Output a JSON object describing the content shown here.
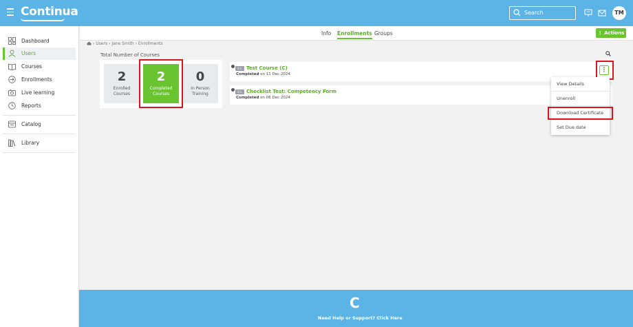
{
  "header": {
    "logo": "Continua",
    "search_placeholder": "Search",
    "avatar_initials": "TM"
  },
  "sidebar": {
    "items": [
      {
        "label": "Dashboard",
        "icon": "dashboard-icon"
      },
      {
        "label": "Users",
        "icon": "user-icon",
        "active": true
      },
      {
        "label": "Courses",
        "icon": "book-icon"
      },
      {
        "label": "Enrollments",
        "icon": "enroll-icon"
      },
      {
        "label": "Live learning",
        "icon": "live-learning-icon"
      },
      {
        "label": "Reports",
        "icon": "reports-icon"
      },
      {
        "label": "Catalog",
        "icon": "catalog-icon"
      },
      {
        "label": "Library",
        "icon": "library-icon"
      }
    ]
  },
  "tabs": [
    {
      "label": "Info"
    },
    {
      "label": "Enrollments",
      "active": true
    },
    {
      "label": "Groups"
    }
  ],
  "actions_label": "⋮ Actions",
  "breadcrumb": {
    "home_icon": "home-icon",
    "items": [
      "Users",
      "Jane Smith",
      "Enrollments"
    ],
    "separator": "›"
  },
  "stats": {
    "title": "Total Number of Courses",
    "cards": [
      {
        "value": "2",
        "label_line1": "Enrolled",
        "label_line2": "Courses"
      },
      {
        "value": "2",
        "label_line1": "Completed",
        "label_line2": "Courses"
      },
      {
        "value": "0",
        "label_line1": "In Person",
        "label_line2": "Training"
      }
    ]
  },
  "courses": [
    {
      "badge": "E-L",
      "title": "Test Course (C)",
      "status": "Completed",
      "date_text": "on 11 Dec 2024"
    },
    {
      "badge": "E-L",
      "title": "Checklist Test: Competency Form",
      "status": "Completed",
      "date_text": "on 06 Dec 2024"
    }
  ],
  "menu": {
    "items": [
      "View Details",
      "Unenroll",
      "Download Certificate",
      "Set Due date"
    ]
  },
  "footer": {
    "logo_letter": "C",
    "help_text": "Need Help or Support? Click Here"
  },
  "colors": {
    "header_blue": "#5bb4e5",
    "accent_green": "#6ac431",
    "highlight_red": "#d9141c"
  }
}
